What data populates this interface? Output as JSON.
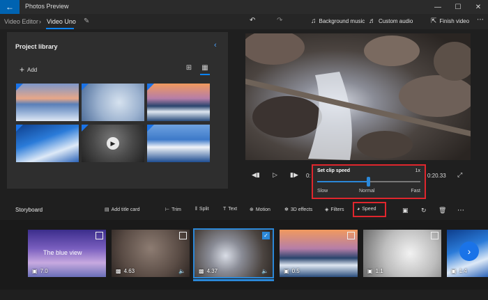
{
  "app": {
    "title": "Photos Preview"
  },
  "toolbar": {
    "breadcrumb_root": "Video Editor",
    "breadcrumb_current": "Video Uno",
    "background_music": "Background music",
    "custom_audio": "Custom audio",
    "finish_video": "Finish video"
  },
  "library": {
    "title": "Project library",
    "add_label": "Add"
  },
  "player": {
    "time_left": "0:",
    "time_right": "0:20.33"
  },
  "speed_popup": {
    "title": "Set clip speed",
    "rate": "1x",
    "slow": "Slow",
    "normal": "Normal",
    "fast": "Fast",
    "value_fraction": 0.5
  },
  "storyboard": {
    "title": "Storyboard",
    "add_title_card": "Add title card",
    "trim": "Trim",
    "split": "Split",
    "text": "Text",
    "motion": "Motion",
    "effects_3d": "3D effects",
    "filters": "Filters",
    "speed": "Speed",
    "clips": [
      {
        "overlay_text": "The blue view",
        "duration": "7.0"
      },
      {
        "duration": "4.63"
      },
      {
        "duration": "4.37"
      },
      {
        "duration": "0.5"
      },
      {
        "duration": "1.1"
      },
      {
        "duration": "1.4"
      }
    ]
  },
  "colors": {
    "accent": "#0a84ff",
    "highlight": "#e0262d"
  }
}
